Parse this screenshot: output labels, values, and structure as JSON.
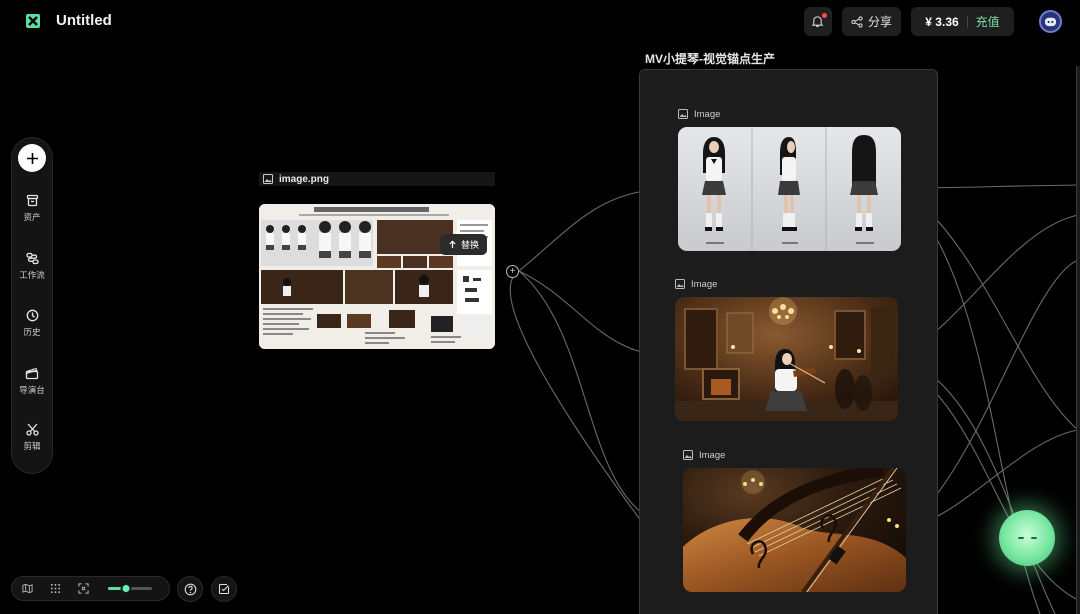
{
  "header": {
    "title": "Untitled",
    "share_label": "分享",
    "balance": "¥ 3.36",
    "recharge_label": "充值"
  },
  "sidebar": {
    "items": [
      {
        "icon": "assets-icon",
        "label": "资产"
      },
      {
        "icon": "workflow-icon",
        "label": "工作流"
      },
      {
        "icon": "history-icon",
        "label": "历史"
      },
      {
        "icon": "director-icon",
        "label": "导演台"
      },
      {
        "icon": "scissors-icon",
        "label": "剪辑"
      }
    ]
  },
  "zoom": {
    "level": 0.4
  },
  "canvas": {
    "source_node": {
      "filename": "image.png",
      "replace_label": "替换"
    },
    "group": {
      "title": "MV小提琴-视觉锚点生产",
      "nodes": [
        {
          "label": "Image",
          "content": "character turnaround"
        },
        {
          "label": "Image",
          "content": "violinist in ornate hall"
        },
        {
          "label": "Image",
          "content": "violin close-up"
        }
      ]
    }
  },
  "colors": {
    "accent": "#6ef0b0",
    "notification": "#ff4d4f",
    "background": "#000000"
  }
}
